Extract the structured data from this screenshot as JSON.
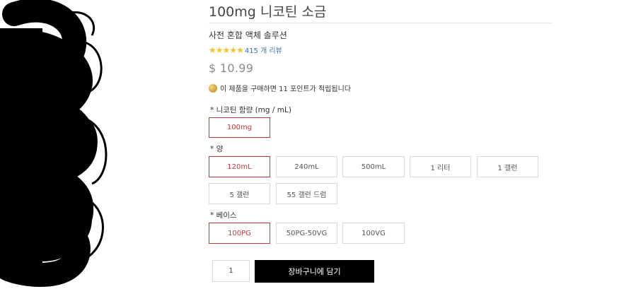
{
  "product": {
    "title": "100mg 니코틴 소금",
    "subtitle": "사전 혼합 액체 솔루션",
    "stars": 5,
    "reviews_label": "415 개 리뷰",
    "price": "$ 10.99",
    "points_text": "이 제품을 구매하면 11 포인트가 적립됩니다"
  },
  "options": {
    "nicotine": {
      "label": "*  니코틴 함량 (mg / mL)",
      "values": [
        "100mg"
      ],
      "selected": "100mg"
    },
    "volume": {
      "label": "*  양",
      "values": [
        "120mL",
        "240mL",
        "500mL",
        "1 리터",
        "1 갤런",
        "5 갤런",
        "55 갤런 드럼"
      ],
      "selected": "120mL"
    },
    "base": {
      "label": "*  베이스",
      "values": [
        "100PG",
        "50PG-50VG",
        "100VG"
      ],
      "selected": "100PG"
    }
  },
  "cart": {
    "quantity": "1",
    "add_label": "장바구니에 담기"
  },
  "colors": {
    "accent": "#c0393b",
    "star": "#f3c623",
    "link": "#3a73b6"
  },
  "icons": {
    "points": "coin-icon",
    "rating": "star-icon"
  }
}
